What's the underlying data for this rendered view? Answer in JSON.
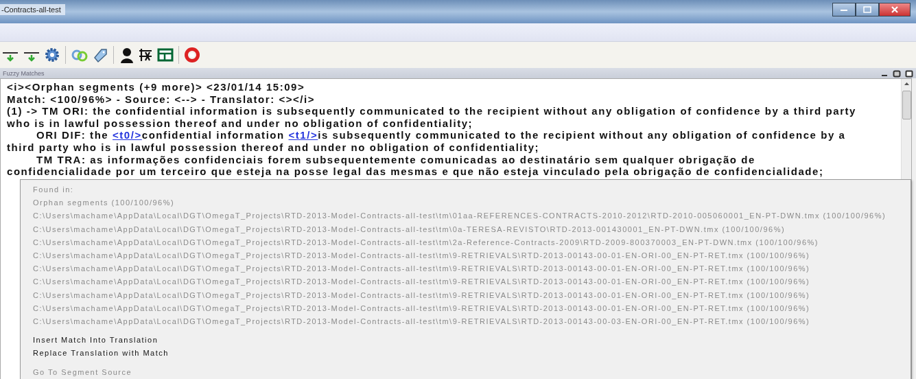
{
  "window": {
    "title": "-Contracts-all-test"
  },
  "pane": {
    "title": "Fuzzy Matches"
  },
  "match_lines": [
    {
      "indent": false,
      "parts": [
        {
          "kind": "text",
          "text": "<i><Orphan segments (+9 more)> <23/01/14 15:09>"
        }
      ]
    },
    {
      "indent": false,
      "parts": [
        {
          "kind": "text",
          "text": "Match: <100/96%> - Source: <--> - Translator: <></i>"
        }
      ]
    },
    {
      "indent": false,
      "parts": [
        {
          "kind": "text",
          "text": "(1) -> TM ORI: the confidential information is subsequently communicated to the recipient without any obligation of confidence by a third party"
        }
      ]
    },
    {
      "indent": false,
      "parts": [
        {
          "kind": "text",
          "text": "who is in lawful possession thereof and under no obligation of confidentiality;"
        }
      ]
    },
    {
      "indent": true,
      "parts": [
        {
          "kind": "text",
          "text": "ORI DIF: the "
        },
        {
          "kind": "tag",
          "text": "<t0/>"
        },
        {
          "kind": "text",
          "text": "confidential information "
        },
        {
          "kind": "tag",
          "text": "<t1/>"
        },
        {
          "kind": "text",
          "text": "is subsequently communicated to the recipient without any obligation of confidence by a"
        }
      ]
    },
    {
      "indent": false,
      "parts": [
        {
          "kind": "text",
          "text": "third party who is in lawful possession thereof and under no obligation of confidentiality;"
        }
      ]
    },
    {
      "indent": true,
      "parts": [
        {
          "kind": "text",
          "text": "TM TRA: as informações confidenciais forem subsequentemente comunicadas ao destinatário sem qualquer obrigação de"
        }
      ]
    },
    {
      "indent": false,
      "parts": [
        {
          "kind": "text",
          "text": "confidencialidade por um terceiro que esteja na posse legal das mesmas e que não esteja vinculado pela obrigação de confidencialidade;"
        }
      ]
    }
  ],
  "context_menu": [
    {
      "kind": "item",
      "label": "Found in:",
      "disabled": true
    },
    {
      "kind": "item",
      "label": "Orphan segments (100/100/96%)",
      "disabled": true
    },
    {
      "kind": "item",
      "label": "C:\\Users\\machame\\AppData\\Local\\DGT\\OmegaT_Projects\\RTD-2013-Model-Contracts-all-test\\tm\\01aa-REFERENCES-CONTRACTS-2010-2012\\RTD-2010-005060001_EN-PT-DWN.tmx (100/100/96%)",
      "disabled": true
    },
    {
      "kind": "item",
      "label": "C:\\Users\\machame\\AppData\\Local\\DGT\\OmegaT_Projects\\RTD-2013-Model-Contracts-all-test\\tm\\0a-TERESA-REVISTO\\RTD-2013-001430001_EN-PT-DWN.tmx (100/100/96%)",
      "disabled": true
    },
    {
      "kind": "item",
      "label": "C:\\Users\\machame\\AppData\\Local\\DGT\\OmegaT_Projects\\RTD-2013-Model-Contracts-all-test\\tm\\2a-Reference-Contracts-2009\\RTD-2009-800370003_EN-PT-DWN.tmx (100/100/96%)",
      "disabled": true
    },
    {
      "kind": "item",
      "label": "C:\\Users\\machame\\AppData\\Local\\DGT\\OmegaT_Projects\\RTD-2013-Model-Contracts-all-test\\tm\\9-RETRIEVALS\\RTD-2013-00143-00-01-EN-ORI-00_EN-PT-RET.tmx (100/100/96%)",
      "disabled": true
    },
    {
      "kind": "item",
      "label": "C:\\Users\\machame\\AppData\\Local\\DGT\\OmegaT_Projects\\RTD-2013-Model-Contracts-all-test\\tm\\9-RETRIEVALS\\RTD-2013-00143-00-01-EN-ORI-00_EN-PT-RET.tmx (100/100/96%)",
      "disabled": true
    },
    {
      "kind": "item",
      "label": "C:\\Users\\machame\\AppData\\Local\\DGT\\OmegaT_Projects\\RTD-2013-Model-Contracts-all-test\\tm\\9-RETRIEVALS\\RTD-2013-00143-00-01-EN-ORI-00_EN-PT-RET.tmx (100/100/96%)",
      "disabled": true
    },
    {
      "kind": "item",
      "label": "C:\\Users\\machame\\AppData\\Local\\DGT\\OmegaT_Projects\\RTD-2013-Model-Contracts-all-test\\tm\\9-RETRIEVALS\\RTD-2013-00143-00-01-EN-ORI-00_EN-PT-RET.tmx (100/100/96%)",
      "disabled": true
    },
    {
      "kind": "item",
      "label": "C:\\Users\\machame\\AppData\\Local\\DGT\\OmegaT_Projects\\RTD-2013-Model-Contracts-all-test\\tm\\9-RETRIEVALS\\RTD-2013-00143-00-01-EN-ORI-00_EN-PT-RET.tmx (100/100/96%)",
      "disabled": true
    },
    {
      "kind": "item",
      "label": "C:\\Users\\machame\\AppData\\Local\\DGT\\OmegaT_Projects\\RTD-2013-Model-Contracts-all-test\\tm\\9-RETRIEVALS\\RTD-2013-00143-00-03-EN-ORI-00_EN-PT-RET.tmx (100/100/96%)",
      "disabled": true
    },
    {
      "kind": "separator"
    },
    {
      "kind": "item",
      "label": "Insert Match Into Translation",
      "disabled": false
    },
    {
      "kind": "item",
      "label": "Replace Translation with Match",
      "disabled": false
    },
    {
      "kind": "separator"
    },
    {
      "kind": "item",
      "label": "Go To Segment Source",
      "disabled": true
    }
  ]
}
